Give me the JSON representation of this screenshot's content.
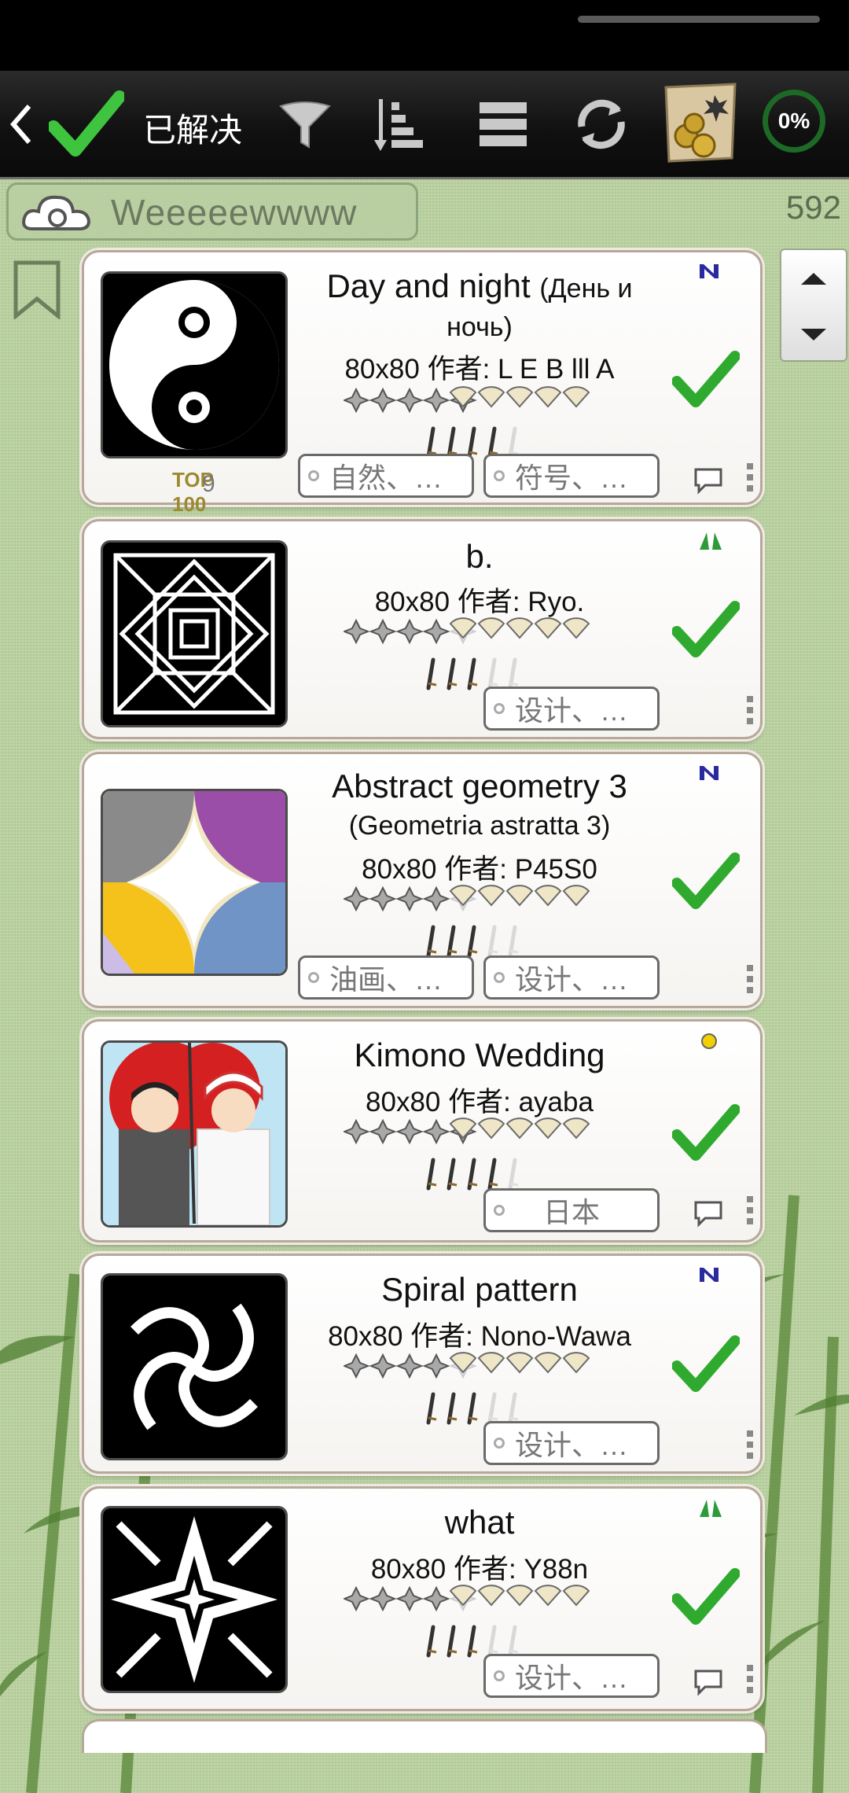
{
  "toolbar": {
    "solved_label": "已解决",
    "progress": "0%"
  },
  "search": {
    "placeholder": "Weeeeewwww"
  },
  "count": "592",
  "puzzles": [
    {
      "title": "Day and night",
      "subtitle": "(День и ночь)",
      "size": "80x80",
      "author_prefix": "作者:",
      "author": "L E B lll A",
      "tags": [
        "自然、…",
        "符号、…"
      ],
      "badge": "N",
      "top100": "9",
      "stars": 4.5,
      "fans": 4.5,
      "swords": 4
    },
    {
      "title": "b.",
      "subtitle": "",
      "size": "80x80",
      "author_prefix": "作者:",
      "author": "Ryo.",
      "tags": [
        "设计、…"
      ],
      "badge": "leaf",
      "stars": 3.5,
      "fans": 4.5,
      "swords": 3
    },
    {
      "title": "Abstract geometry 3",
      "subtitle": "(Geometria astratta 3)",
      "size": "80x80",
      "author_prefix": "作者:",
      "author": "P45S0",
      "tags": [
        "油画、…",
        "设计、…"
      ],
      "badge": "N",
      "stars": 4,
      "fans": 4.5,
      "swords": 3
    },
    {
      "title": "Kimono Wedding",
      "subtitle": "",
      "size": "80x80",
      "author_prefix": "作者:",
      "author": "ayaba",
      "tags": [
        "日本"
      ],
      "badge": "dot",
      "stars": 4.5,
      "fans": 4.5,
      "swords": 3.5
    },
    {
      "title": "Spiral pattern",
      "subtitle": "",
      "size": "80x80",
      "author_prefix": "作者:",
      "author": "Nono-Wawa",
      "tags": [
        "设计、…"
      ],
      "badge": "N",
      "stars": 4,
      "fans": 4.5,
      "swords": 3
    },
    {
      "title": "what",
      "subtitle": "",
      "size": "80x80",
      "author_prefix": "作者:",
      "author": "Y88n",
      "tags": [
        "设计、…"
      ],
      "badge": "leaf",
      "stars": 4,
      "fans": 4.5,
      "swords": 3
    }
  ],
  "colors": {
    "check": "#2faa2f",
    "badge_n": "#2a2aa0",
    "badge_leaf": "#2e9b3a",
    "badge_dot": "#f0d000"
  },
  "icons": [
    "back-icon",
    "solved-check-icon",
    "filter-icon",
    "sort-icon",
    "menu-icon",
    "refresh-icon",
    "treasure-map-icon",
    "cloud-search-icon",
    "bookmark-icon",
    "scroll-up-icon",
    "scroll-down-icon",
    "checkmark-icon",
    "comment-icon",
    "kebab-icon"
  ]
}
